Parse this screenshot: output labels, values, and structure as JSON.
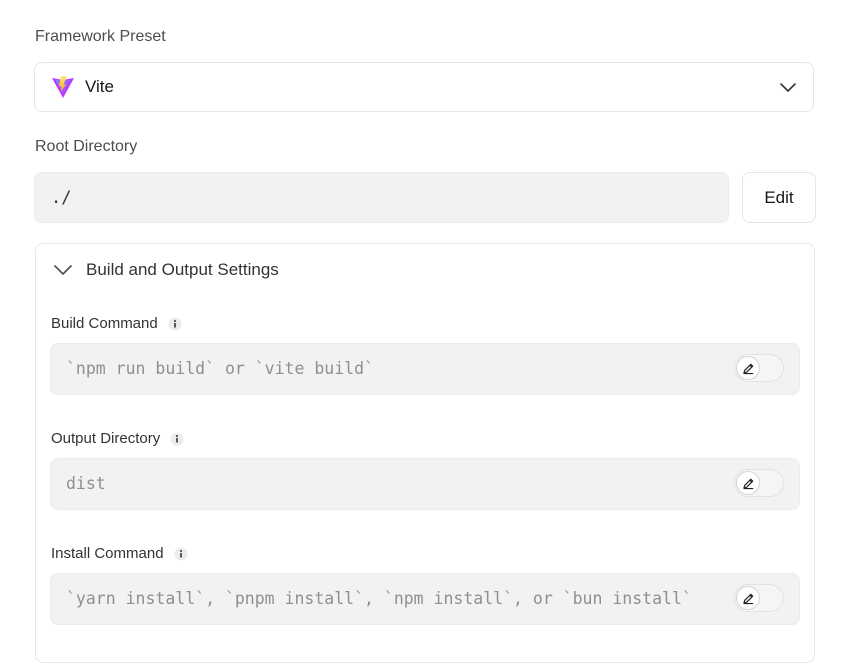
{
  "framework": {
    "label": "Framework Preset",
    "selected": "Vite",
    "logo_icon": "vite-logo-icon",
    "chevron_icon": "chevron-down-icon"
  },
  "root_directory": {
    "label": "Root Directory",
    "value": "./",
    "edit_label": "Edit"
  },
  "build_settings": {
    "title": "Build and Output Settings",
    "expanded": true,
    "fields": [
      {
        "label": "Build Command",
        "placeholder": "`npm run build` or `vite build`",
        "override": false
      },
      {
        "label": "Output Directory",
        "placeholder": "dist",
        "override": false
      },
      {
        "label": "Install Command",
        "placeholder": "`yarn install`, `pnpm install`, `npm install`, or `bun install`",
        "override": false
      }
    ]
  },
  "colors": {
    "vite_purple": "#a855f7",
    "vite_yellow": "#facc15",
    "field_bg": "#f2f2f2"
  }
}
